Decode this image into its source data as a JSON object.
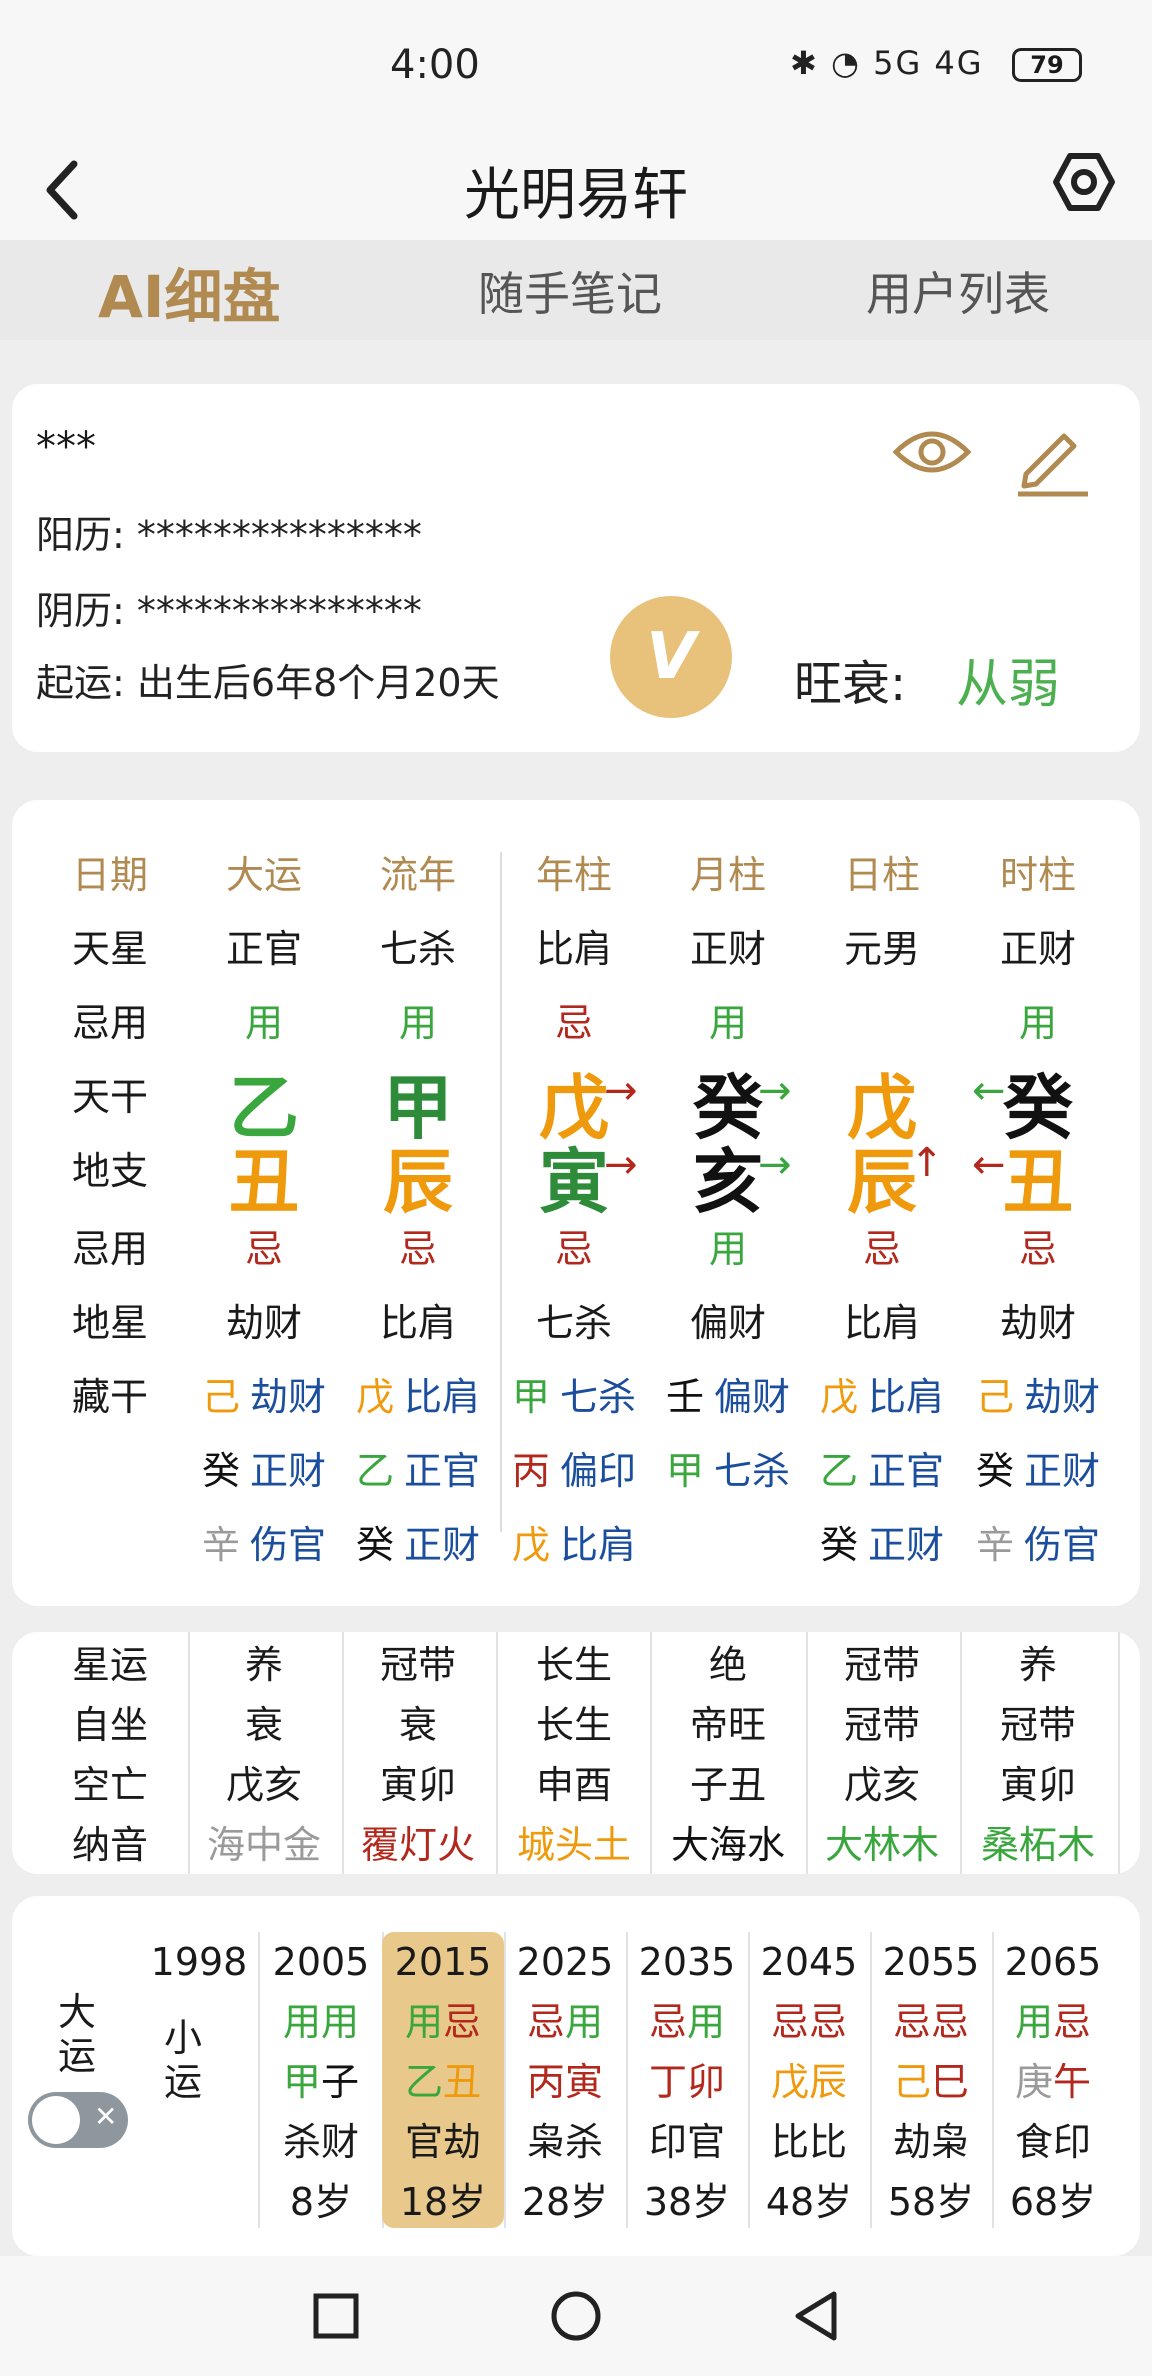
{
  "status": {
    "time": "4:00",
    "icons": "✱ ◔ 5G 4G",
    "battery": "79"
  },
  "header": {
    "title": "光明易轩",
    "back_icon": "chevron-left-icon",
    "settings_icon": "hexagon-settings-icon"
  },
  "tabs": [
    {
      "label": "AI细盘",
      "active": true
    },
    {
      "label": "随手笔记"
    },
    {
      "label": "用户列表"
    }
  ],
  "profile": {
    "name": "***",
    "solar_label": "阳历:",
    "solar_value": "***************",
    "lunar_label": "阴历:",
    "lunar_value": "***************",
    "qiyun_label": "起运:",
    "qiyun_value": "出生后6年8个月20天",
    "vip_badge": "V",
    "wangshuai_label": "旺衰:",
    "wangshuai_value": "从弱"
  },
  "chart": {
    "headers": [
      "日期",
      "大运",
      "流年",
      "年柱",
      "月柱",
      "日柱",
      "时柱"
    ],
    "tianxing": [
      "天星",
      "正官",
      "七杀",
      "比肩",
      "正财",
      "元男",
      "正财"
    ],
    "jiyong1": [
      "忌用",
      "用",
      "用",
      "忌",
      "用",
      "",
      "用"
    ],
    "tiangan": [
      "天干",
      "乙",
      "甲",
      "戊",
      "癸",
      "戊",
      "癸"
    ],
    "dizhi": [
      "地支",
      "丑",
      "辰",
      "寅",
      "亥",
      "辰",
      "丑"
    ],
    "jiyong2": [
      "忌用",
      "忌",
      "忌",
      "忌",
      "用",
      "忌",
      "忌"
    ],
    "dixing": [
      "地星",
      "劫财",
      "比肩",
      "七杀",
      "偏财",
      "比肩",
      "劫财"
    ],
    "canggan_label": "藏干",
    "canggan": [
      [
        [
          "己",
          "劫财"
        ],
        [
          "戊",
          "比肩"
        ],
        [
          "甲",
          "七杀"
        ],
        [
          "壬",
          "偏财"
        ],
        [
          "戊",
          "比肩"
        ],
        [
          "己",
          "劫财"
        ]
      ],
      [
        [
          "癸",
          "正财"
        ],
        [
          "乙",
          "正官"
        ],
        [
          "丙",
          "偏印"
        ],
        [
          "甲",
          "七杀"
        ],
        [
          "乙",
          "正官"
        ],
        [
          "癸",
          "正财"
        ]
      ],
      [
        [
          "辛",
          "伤官"
        ],
        [
          "癸",
          "正财"
        ],
        [
          "戊",
          "比肩"
        ],
        [
          "",
          ""
        ],
        [
          "癸",
          "正财"
        ],
        [
          "辛",
          "伤官"
        ]
      ]
    ],
    "arrows": {
      "year_gan": "→",
      "year_zhi": "→",
      "month_gan": "→",
      "month_zhi": "→",
      "day_zhi": "↑",
      "hour_gan": "←",
      "hour_zhi": "←"
    }
  },
  "extra": {
    "rows": [
      [
        "星运",
        "养",
        "冠带",
        "长生",
        "绝",
        "冠带",
        "养"
      ],
      [
        "自坐",
        "衰",
        "衰",
        "长生",
        "帝旺",
        "冠带",
        "冠带"
      ],
      [
        "空亡",
        "戊亥",
        "寅卯",
        "申酉",
        "子丑",
        "戊亥",
        "寅卯"
      ],
      [
        "纳音",
        "海中金",
        "覆灯火",
        "城头土",
        "大海水",
        "大林木",
        "桑柘木"
      ]
    ]
  },
  "luck": {
    "dayun_label": "大运",
    "xiaoyun_label": "小运",
    "start_year": "1998",
    "columns": [
      {
        "year": "2005",
        "jy": [
          "用",
          "用"
        ],
        "gz": [
          "甲",
          "子"
        ],
        "shen": "杀财",
        "age": "8岁"
      },
      {
        "year": "2015",
        "jy": [
          "用",
          "忌"
        ],
        "gz": [
          "乙",
          "丑"
        ],
        "shen": "官劫",
        "age": "18岁",
        "active": true
      },
      {
        "year": "2025",
        "jy": [
          "忌",
          "用"
        ],
        "gz": [
          "丙",
          "寅"
        ],
        "shen": "枭杀",
        "age": "28岁"
      },
      {
        "year": "2035",
        "jy": [
          "忌",
          "用"
        ],
        "gz": [
          "丁",
          "卯"
        ],
        "shen": "印官",
        "age": "38岁"
      },
      {
        "year": "2045",
        "jy": [
          "忌",
          "忌"
        ],
        "gz": [
          "戊",
          "辰"
        ],
        "shen": "比比",
        "age": "48岁"
      },
      {
        "year": "2055",
        "jy": [
          "忌",
          "忌"
        ],
        "gz": [
          "己",
          "巳"
        ],
        "shen": "劫枭",
        "age": "58岁"
      },
      {
        "year": "2065",
        "jy": [
          "用",
          "忌"
        ],
        "gz": [
          "庚",
          "午"
        ],
        "shen": "食印",
        "age": "68岁"
      }
    ]
  },
  "navbar": {
    "recent_icon": "square-icon",
    "home_icon": "circle-icon",
    "back_icon": "triangle-back-icon"
  }
}
